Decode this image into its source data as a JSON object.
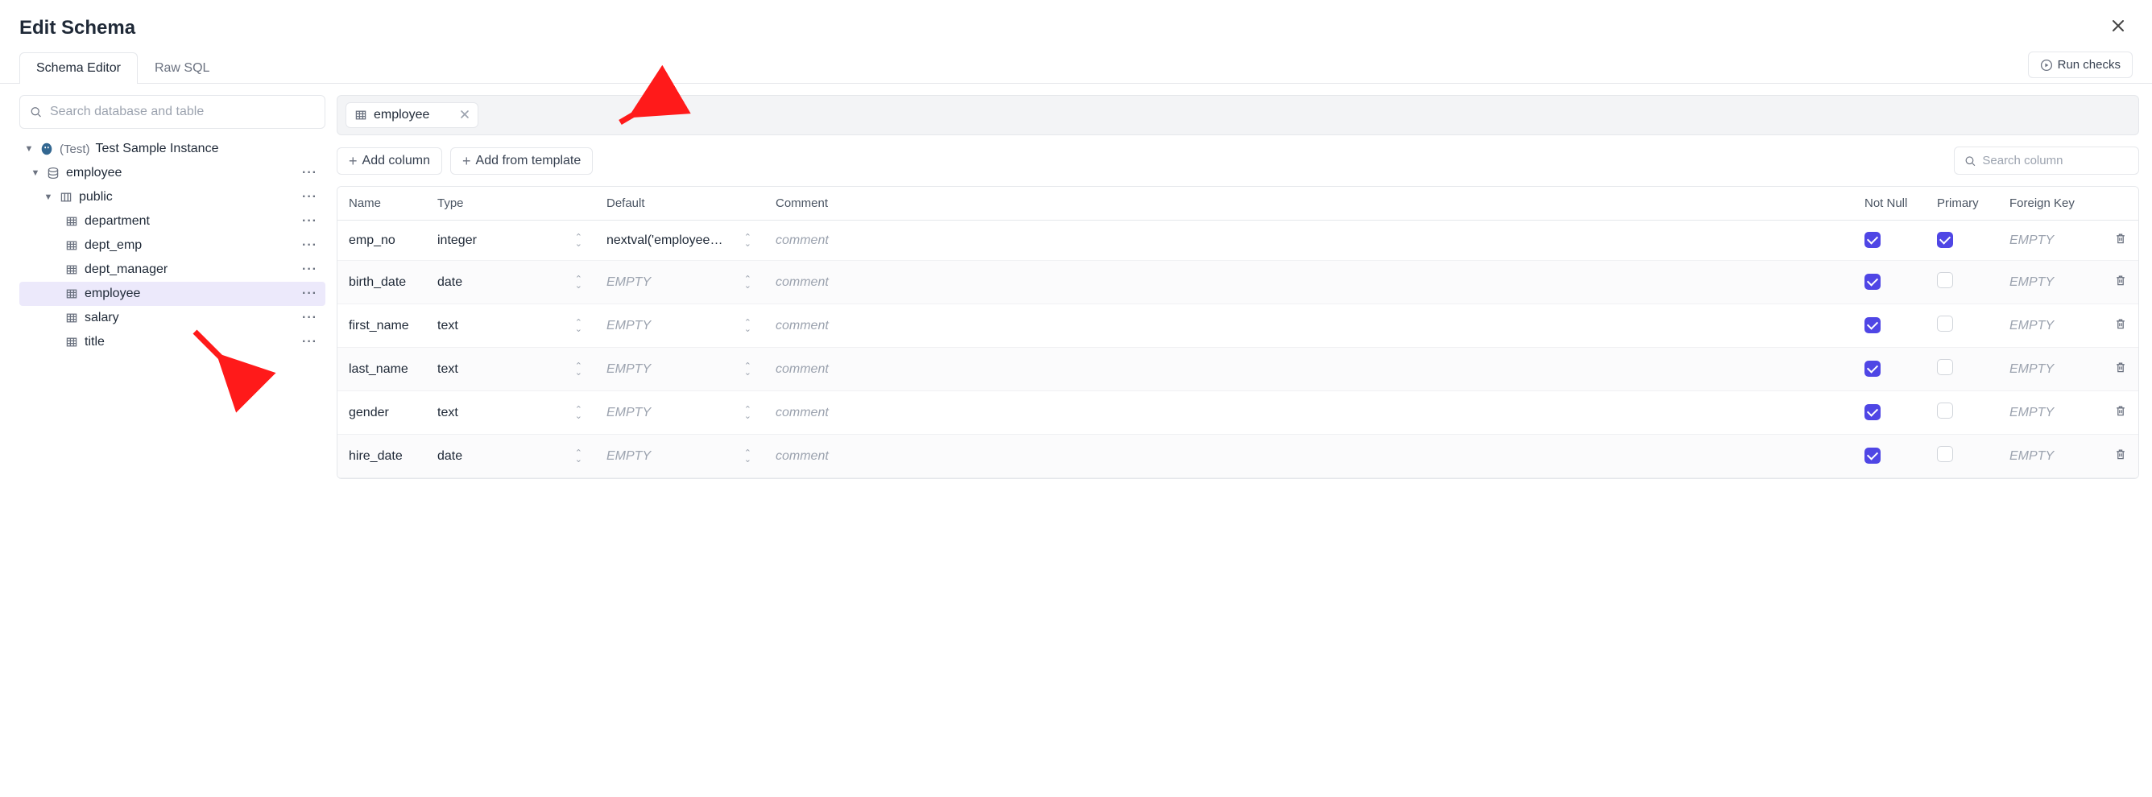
{
  "header": {
    "title": "Edit Schema"
  },
  "tabs": {
    "schema_editor": "Schema Editor",
    "raw_sql": "Raw SQL",
    "run_checks": "Run checks"
  },
  "sidebar": {
    "search_placeholder": "Search database and table",
    "instance_env": "(Test)",
    "instance_name": "Test Sample Instance",
    "database": "employee",
    "schema": "public",
    "tables": [
      {
        "name": "department",
        "selected": false
      },
      {
        "name": "dept_emp",
        "selected": false
      },
      {
        "name": "dept_manager",
        "selected": false
      },
      {
        "name": "employee",
        "selected": true
      },
      {
        "name": "salary",
        "selected": false
      },
      {
        "name": "title",
        "selected": false
      }
    ]
  },
  "main": {
    "breadcrumb": "employee",
    "add_column_label": "Add column",
    "add_template_label": "Add from template",
    "col_search_placeholder": "Search column",
    "headers": {
      "name": "Name",
      "type": "Type",
      "default": "Default",
      "comment": "Comment",
      "not_null": "Not Null",
      "primary": "Primary",
      "foreign_key": "Foreign Key"
    },
    "empty_label": "EMPTY",
    "comment_placeholder": "comment",
    "columns": [
      {
        "name": "emp_no",
        "type": "integer",
        "default": "nextval('employee…",
        "not_null": true,
        "primary": true,
        "fk": "EMPTY"
      },
      {
        "name": "birth_date",
        "type": "date",
        "default": "",
        "not_null": true,
        "primary": false,
        "fk": "EMPTY"
      },
      {
        "name": "first_name",
        "type": "text",
        "default": "",
        "not_null": true,
        "primary": false,
        "fk": "EMPTY"
      },
      {
        "name": "last_name",
        "type": "text",
        "default": "",
        "not_null": true,
        "primary": false,
        "fk": "EMPTY"
      },
      {
        "name": "gender",
        "type": "text",
        "default": "",
        "not_null": true,
        "primary": false,
        "fk": "EMPTY"
      },
      {
        "name": "hire_date",
        "type": "date",
        "default": "",
        "not_null": true,
        "primary": false,
        "fk": "EMPTY"
      }
    ]
  }
}
